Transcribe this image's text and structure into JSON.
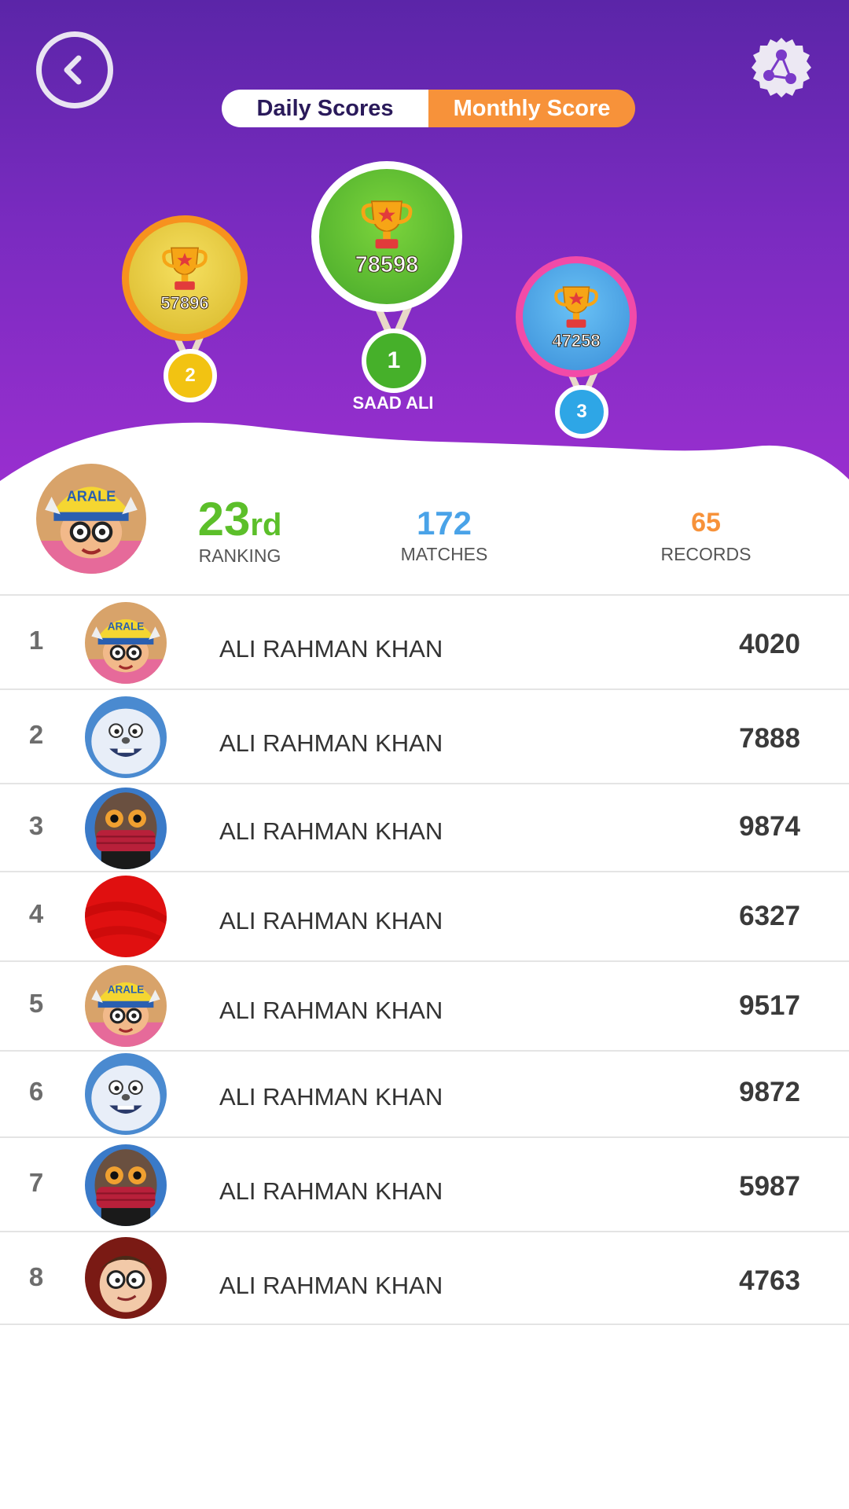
{
  "tabs": {
    "daily": "Daily Scores",
    "monthly": "Monthly Score",
    "active": "monthly"
  },
  "podium": [
    {
      "rank": "1",
      "score": "78598",
      "name": "SAAD ALI",
      "color": "#5cbf2a"
    },
    {
      "rank": "2",
      "score": "57896",
      "color": "#f2c312"
    },
    {
      "rank": "3",
      "score": "47258",
      "color": "#2ea6e6"
    }
  ],
  "me": {
    "ranking_value": "23",
    "ranking_suffix": "rd",
    "ranking_label": "RANKING",
    "matches_value": "172",
    "matches_label": "MATCHES",
    "records_value": "65",
    "records_label": "RECORDS"
  },
  "leaderboard": [
    {
      "rank": "1",
      "name": "ALI RAHMAN KHAN",
      "score": "4020",
      "avatar": "girl-avatar"
    },
    {
      "rank": "2",
      "name": "ALI RAHMAN KHAN",
      "score": "7888",
      "avatar": "yeti-avatar"
    },
    {
      "rank": "3",
      "name": "ALI RAHMAN KHAN",
      "score": "9874",
      "avatar": "owl-avatar"
    },
    {
      "rank": "4",
      "name": "ALI RAHMAN KHAN",
      "score": "6327",
      "avatar": "red-avatar"
    },
    {
      "rank": "5",
      "name": "ALI RAHMAN KHAN",
      "score": "9517",
      "avatar": "girl-avatar"
    },
    {
      "rank": "6",
      "name": "ALI RAHMAN KHAN",
      "score": "9872",
      "avatar": "yeti-avatar"
    },
    {
      "rank": "7",
      "name": "ALI RAHMAN KHAN",
      "score": "5987",
      "avatar": "owl-avatar"
    },
    {
      "rank": "8",
      "name": "ALI RAHMAN KHAN",
      "score": "4763",
      "avatar": "boy-avatar"
    }
  ],
  "colors": {
    "primary": "#6a27b8",
    "accent": "#f7923a",
    "green": "#5cbf2a",
    "blue": "#4aa3e8"
  }
}
